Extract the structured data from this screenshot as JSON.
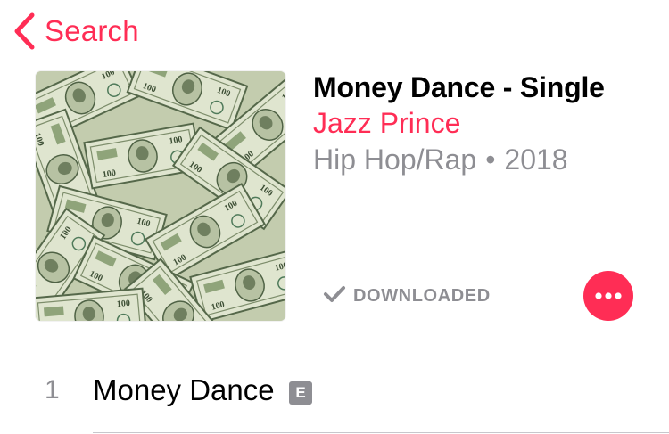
{
  "nav": {
    "back_label": "Search",
    "back_icon": "chevron-left-icon"
  },
  "album": {
    "artwork_icon": "album-artwork-money-bills",
    "title": "Money Dance - Single",
    "artist": "Jazz Prince",
    "genre": "Hip Hop/Rap",
    "separator": "•",
    "year": "2018",
    "download_status": "DOWNLOADED",
    "download_icon": "checkmark-icon",
    "more_icon": "ellipsis-icon"
  },
  "tracks": [
    {
      "number": "1",
      "title": "Money Dance",
      "explicit_badge": "E"
    }
  ],
  "colors": {
    "accent": "#ff2d55",
    "secondary_text": "#8e8e93",
    "divider": "#c8c7cc"
  }
}
